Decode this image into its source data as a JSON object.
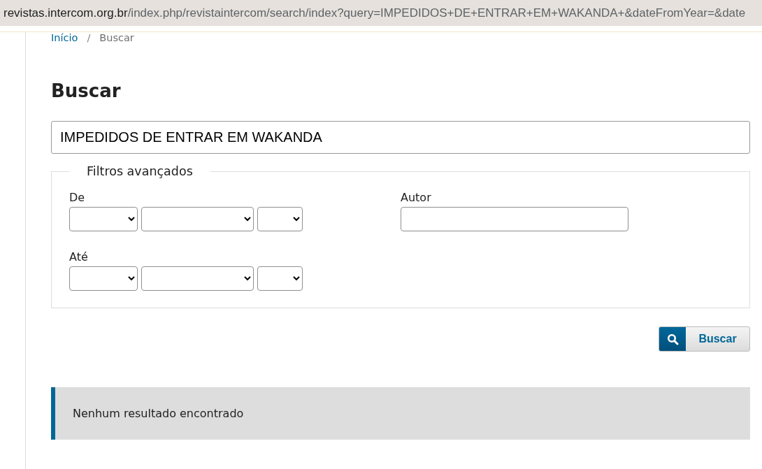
{
  "address_bar": {
    "domain": "revistas.intercom.org.br",
    "path": "/index.php/revistaintercom/search/index?query=IMPEDIDOS+DE+ENTRAR+EM+WAKANDA+&dateFromYear=&date"
  },
  "breadcrumb": {
    "items": [
      {
        "label": "Início",
        "kind": "link"
      },
      {
        "label": "Buscar",
        "kind": "current"
      }
    ],
    "separator": "/"
  },
  "title": "Buscar",
  "search": {
    "value": "IMPEDIDOS DE ENTRAR EM WAKANDA"
  },
  "filters": {
    "legend": "Filtros avançados",
    "fields": [
      {
        "kind": "date",
        "label": "De"
      },
      {
        "kind": "text",
        "label": "Autor"
      },
      {
        "kind": "date",
        "label": "Até"
      }
    ]
  },
  "submit": {
    "label": "Buscar"
  },
  "notice": {
    "text": "Nenhum resultado encontrado"
  }
}
